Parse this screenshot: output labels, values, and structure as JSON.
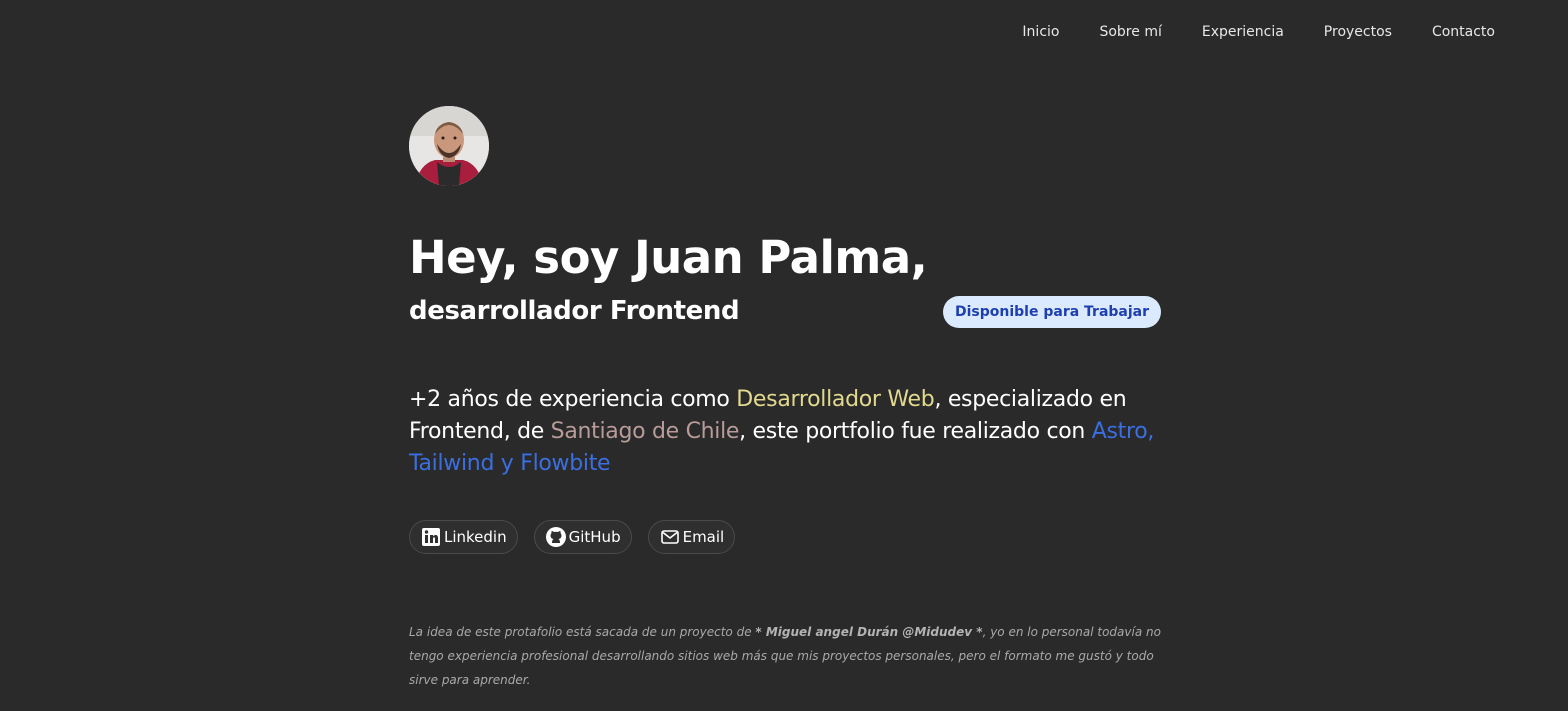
{
  "nav": {
    "items": [
      "Inicio",
      "Sobre mí",
      "Experiencia",
      "Proyectos",
      "Contacto"
    ]
  },
  "hero": {
    "avatar_icon": "profile-photo",
    "title": "Hey, soy Juan Palma,",
    "subtitle": "desarrollador Frontend",
    "badge": "Disponible para Trabajar",
    "intro": {
      "part1": "+2 años de experiencia como ",
      "highlight1": "Desarrollador Web",
      "part2": ", especializado en Frontend, de ",
      "highlight2": "Santiago de Chile",
      "part3": ", este portfolio fue realizado con ",
      "highlight3": "Astro, Tailwind y Flowbite"
    },
    "colors": {
      "background": "#2a2a2a",
      "highlight_yellow": "#e2d98f",
      "highlight_rose": "#b89c9a",
      "highlight_blue": "#3b6fe0",
      "badge_bg": "#dbeafe",
      "badge_text": "#1e40af"
    }
  },
  "social": [
    {
      "label": "Linkedin",
      "icon": "linkedin-icon"
    },
    {
      "label": "GitHub",
      "icon": "github-icon"
    },
    {
      "label": "Email",
      "icon": "mail-icon"
    }
  ],
  "note": {
    "part1": "La idea de este protafolio está sacada de un proyecto de ",
    "author": "* Miguel angel Durán @Midudev *",
    "part2": ", yo en lo personal todavía no tengo experiencia profesional desarrollando sitios web más que mis proyectos personales, pero el formato me gustó y todo sirve para aprender."
  }
}
